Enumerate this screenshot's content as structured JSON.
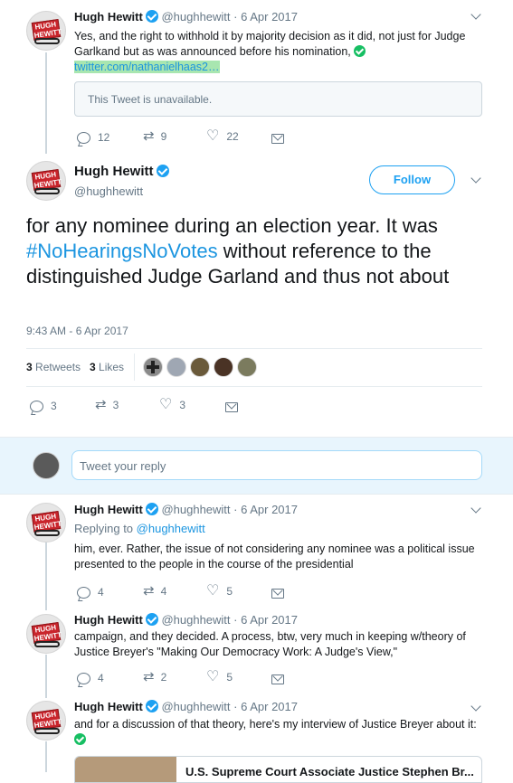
{
  "tweet1": {
    "name": "Hugh Hewitt",
    "handle": "@hughhewitt",
    "date": "· 6 Apr 2017",
    "text": "Yes, and the right to withhold it by majority decision as it did, not just for Judge Garlkand but as was announced before his nomination,",
    "link": "twitter.com/nathanielhaas2…",
    "quoted": "This Tweet is unavailable.",
    "replies": "12",
    "retweets": "9",
    "likes": "22"
  },
  "main": {
    "name": "Hugh Hewitt",
    "handle": "@hughhewitt",
    "follow_label": "Follow",
    "text_part1": "for any nominee during an election year.  It was ",
    "hashtag": "#NoHearingsNoVotes",
    "text_part2": " without reference to the distinguished Judge Garland and thus not about",
    "timestamp": "9:43 AM - 6 Apr 2017",
    "retweets_count": "3",
    "retweets_label": "Retweets",
    "likes_count": "3",
    "likes_label": "Likes",
    "replies": "3",
    "retweets": "3",
    "likes": "3"
  },
  "reply_box": {
    "placeholder": "Tweet your reply"
  },
  "tweet3": {
    "name": "Hugh Hewitt",
    "handle": "@hughhewitt",
    "date": "· 6 Apr 2017",
    "replying_label": "Replying to",
    "replying_to": "@hughhewitt",
    "text": "him, ever.  Rather, the issue of not considering any nominee was a political issue presented to the people in the course of the presidential",
    "replies": "4",
    "retweets": "4",
    "likes": "5"
  },
  "tweet4": {
    "name": "Hugh Hewitt",
    "handle": "@hughhewitt",
    "date": "· 6 Apr 2017",
    "text": "campaign, and they decided.  A process, btw, very much in keeping w/theory of Justice Breyer's \"Making Our Democracy Work: A Judge's View,\"",
    "replies": "4",
    "retweets": "2",
    "likes": "5"
  },
  "tweet5": {
    "name": "Hugh Hewitt",
    "handle": "@hughhewitt",
    "date": "· 6 Apr 2017",
    "text": "and for a discussion of that theory, here's my interview of Justice Breyer about it:",
    "card_title": "U.S. Supreme Court Associate Justice Stephen Br..."
  },
  "avatar_logo": "HUGH HEWITT",
  "colors": {
    "accent": "#1da1f2",
    "link": "#1b95e0",
    "muted": "#657786",
    "link_highlight": "#a8e6b0"
  }
}
